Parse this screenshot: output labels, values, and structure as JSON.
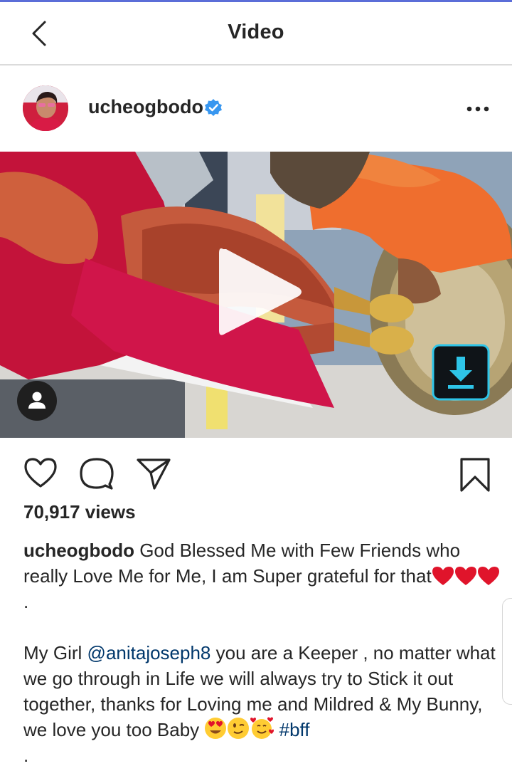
{
  "header": {
    "title": "Video"
  },
  "post": {
    "username": "ucheogbodo",
    "verified": true,
    "views": "70,917 views",
    "caption": {
      "username": "ucheogbodo",
      "line1": " God Blessed Me with Few Friends who really Love Me for Me, I am Super grateful for that",
      "line1_end": ".",
      "para2_start": "My Girl ",
      "mention": "@anitajoseph8",
      "para2_rest": " you are a Keeper , no matter what we go through in Life we will always try to Stick it out together, thanks for Loving me and Mildred & My Bunny, we love you too Baby ",
      "hashtag": "#bff",
      "trailing": "."
    }
  },
  "icons": {
    "back": "chevron-left-icon",
    "verified": "verified-badge-icon",
    "more": "more-horizontal-icon",
    "play": "play-icon",
    "download": "download-icon",
    "tag": "user-tag-icon",
    "like": "heart-icon",
    "comment": "comment-bubble-icon",
    "share": "send-paper-plane-icon",
    "save": "bookmark-icon",
    "emojis": [
      "red-heart",
      "red-heart",
      "red-heart",
      "heart-eyes-face",
      "winking-face",
      "smiling-face-with-hearts"
    ]
  },
  "colors": {
    "text": "#262626",
    "link": "#00376b",
    "verified": "#3897f0",
    "heart": "#e0142b",
    "download_accent": "#2ec5e8",
    "divider": "#dbdbdb"
  }
}
